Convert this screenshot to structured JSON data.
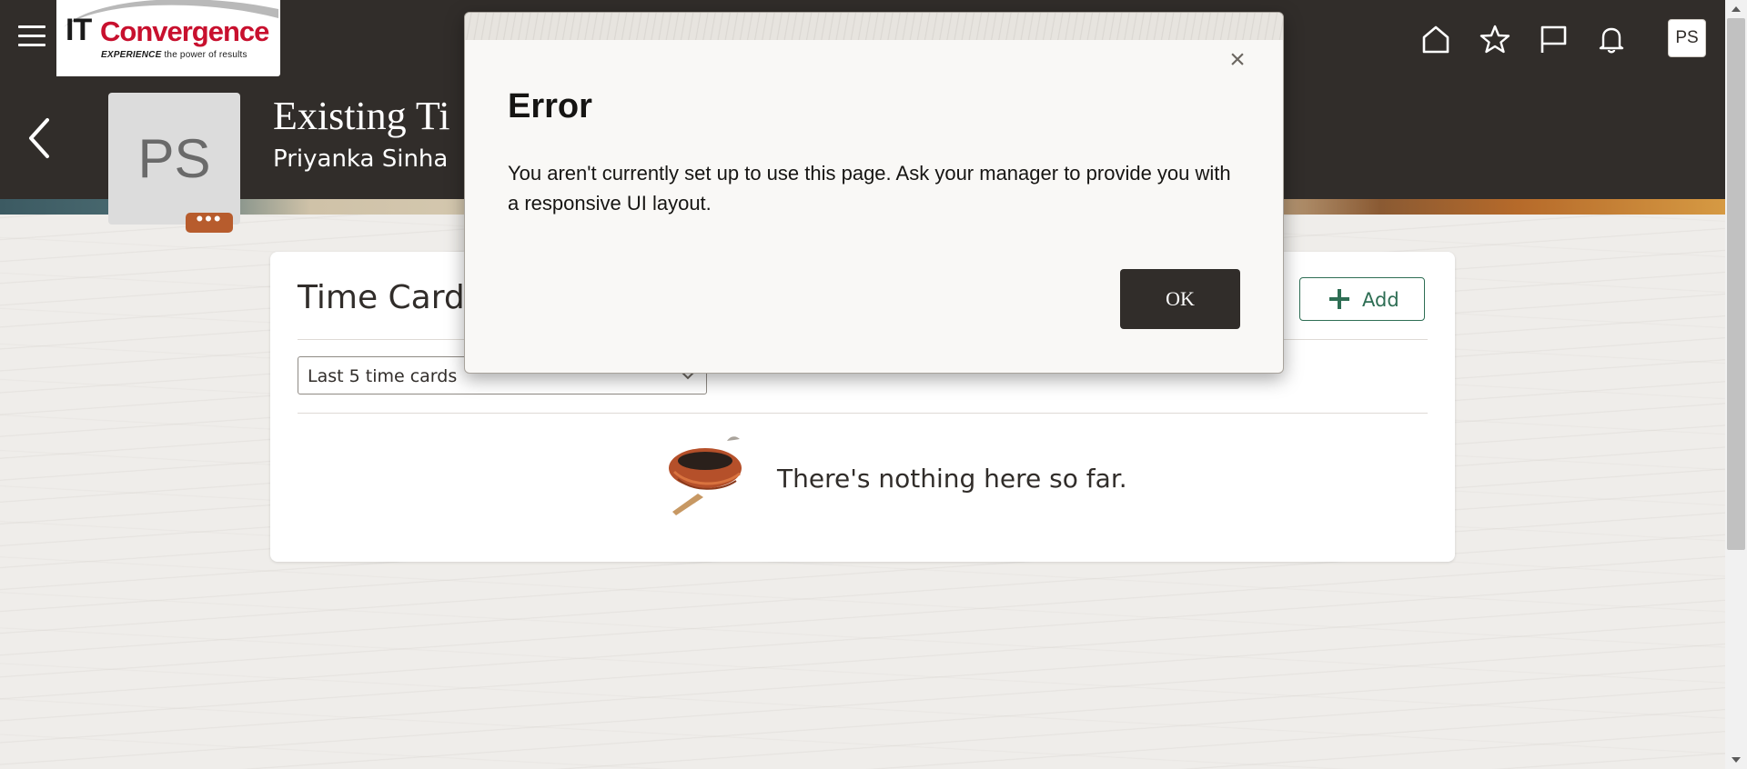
{
  "header": {
    "logo": {
      "brand_it": "IT",
      "brand_name": "Convergence",
      "tagline_bold": "EXPERIENCE",
      "tagline_rest": "the power of results"
    },
    "icons": [
      "home-icon",
      "favorites-star-icon",
      "watchlist-flag-icon",
      "notifications-bell-icon"
    ],
    "user_initials": "PS"
  },
  "page": {
    "title": "Existing Ti",
    "subtitle": "Priyanka Sinha",
    "avatar_initials": "PS",
    "avatar_more": "•••"
  },
  "card": {
    "title": "Time Cards",
    "add_label": "Add",
    "filter_selected": "Last 5 time cards",
    "empty_message": "There's nothing here so far."
  },
  "dialog": {
    "close_glyph": "×",
    "title": "Error",
    "message": "You aren't currently set up to use this page. Ask your manager to provide you with a responsive UI layout.",
    "ok_label": "OK"
  },
  "colors": {
    "header_bg": "#312d2a",
    "accent_green": "#2e6e54",
    "avatar_more_bg": "#b75c2d",
    "brand_red": "#c8102e"
  }
}
